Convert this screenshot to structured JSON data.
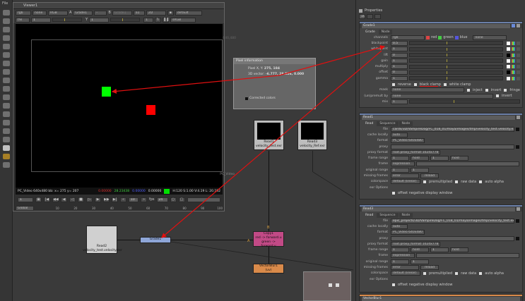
{
  "menu": {
    "file": "File"
  },
  "toolbar_icons": [
    "viewer-icon",
    "paint-icon",
    "time-icon",
    "channel-icon",
    "color-icon",
    "filter-icon",
    "keyer-icon",
    "merge-icon",
    "transform-icon",
    "3d-icon",
    "particles-icon",
    "deep-icon",
    "views-icon",
    "metadata-icon",
    "toolsets-icon",
    "other-icon",
    "gizmo-g-icon",
    "furnace-icon",
    "ocula-icon"
  ],
  "viewer": {
    "title": "Viewer1",
    "row1": [
      "rgb",
      "none",
      "RGB",
      "A",
      "Grade1",
      "-",
      "B",
      "Grade1",
      "a1",
      "2D",
      "default"
    ],
    "row2": {
      "fstop": "f/8",
      "one": "1",
      "gain": "1",
      "y_label": "Y",
      "gamma": "1",
      "proxy": "1",
      "lut": "sRGB"
    },
    "format_label": "PC_Video",
    "format_size": "640,480",
    "status": {
      "info": "PC_Video 640x480 bb: x= 275 y= 207",
      "r": "0.00000",
      "g": "28.23438",
      "b": "0.00000",
      "a": "0.00000",
      "hsvl": "H:120 S:1.00 V:4.19  L: 20.192",
      "swatch": "#00e000"
    },
    "frame": "1",
    "increment": "10",
    "fps_label": "fps",
    "fps": "24",
    "range": "Global",
    "timeline_ticks": [
      "10",
      "20",
      "30",
      "40",
      "50",
      "60",
      "70",
      "80",
      "90",
      "100"
    ]
  },
  "pixel_info": {
    "title": "Pixel information",
    "pixel_label": "Pixel X, Y:",
    "pixel_value": "275, 184",
    "vector_label": "3D vector:",
    "vector_value": "-6.777, 28.526, 0.000",
    "corrected_label": "Corrected colors"
  },
  "properties": {
    "title": "Properties",
    "count": "10",
    "grade": {
      "name": "Grade1",
      "tabs": [
        "Grade",
        "Node"
      ],
      "channels": {
        "label": "channels",
        "value": "rgb",
        "red": "red",
        "green": "green",
        "blue": "blue",
        "none": "none"
      },
      "knobs": [
        {
          "label": "blackpoint",
          "value": "0.5"
        },
        {
          "label": "whitepoint",
          "value": "1"
        },
        {
          "label": "lift",
          "value": "0"
        },
        {
          "label": "gain",
          "value": "1"
        },
        {
          "label": "multiply",
          "value": "1"
        },
        {
          "label": "offset",
          "value": "0"
        },
        {
          "label": "gamma",
          "value": "1"
        }
      ],
      "reverse": "reverse",
      "black_clamp": "black clamp",
      "white_clamp": "white clamp",
      "mask": {
        "label": "mask",
        "value": "none",
        "inject": "inject",
        "invert": "invert",
        "fringe": "fringe"
      },
      "unpremult": {
        "label": "(un)premult by",
        "value": "none",
        "invert": "invert"
      },
      "mix": {
        "label": "mix",
        "value": "1"
      }
    },
    "reads": [
      {
        "name": "Read1",
        "tabs": [
          "Read",
          "Sequence",
          "Node"
        ],
        "file": "cards/3D/VampireDog/FC_018_01/maya/images/tmp/velocity_test.velocity.exr",
        "cache": "auto",
        "format": "PC_Video 640x480",
        "proxy": "",
        "proxy_format": "root.proxy_format 1024x778",
        "frame_range": [
          "1",
          "hold",
          "1",
          "hold"
        ],
        "frame": "expression",
        "original_range": [
          "1",
          "1"
        ],
        "missing_frames": "error",
        "reload": "reload",
        "colorspace": "default (linear)",
        "premultiplied": "premultiplied",
        "raw_data": "raw data",
        "auto_alpha": "auto alpha",
        "exr_options": "exr Options",
        "offset_negative": "offset negative display window"
      },
      {
        "name": "Read3",
        "tabs": [
          "Read",
          "Sequence",
          "Node"
        ],
        "file": "epic_projects/3D/VampireDog/FC_018_01/maya/images/tmp/velocity_test.exr",
        "cache": "auto",
        "format": "PC_Video 640x480",
        "proxy": "",
        "proxy_format": "root.proxy_format 1024x778",
        "frame_range": [
          "1",
          "hold",
          "1",
          "hold"
        ],
        "frame": "expression",
        "original_range": [
          "1",
          "1"
        ],
        "missing_frames": "error",
        "reload": "reload",
        "colorspace": "default (linear)",
        "premultiplied": "premultiplied",
        "raw_data": "raw data",
        "auto_alpha": "auto alpha",
        "exr_options": "exr Options",
        "offset_negative": "offset negative display window"
      }
    ],
    "last_panel": "VectorBlur1"
  },
  "labels": {
    "proxy": "proxy",
    "format": "format",
    "file": "file",
    "cache": "cache locally",
    "proxy_format": "proxy format",
    "frame_range": "frame range",
    "frame": "frame",
    "original_range": "original range",
    "missing_frames": "missing frames",
    "colorspace": "colorspace"
  },
  "nodes": {
    "read1": {
      "name": "Read1",
      "file": "velocity_test.exr"
    },
    "read3": {
      "name": "Read3",
      "file": "velocity_Ref.exr"
    },
    "read2": {
      "name": "Read2",
      "file": "velocity_test.velocity.exr"
    },
    "grade1": {
      "name": "Grade1"
    },
    "copy1": {
      "name": "Copy1",
      "line1": "red -> forward.u",
      "line2": "green -> forward.v",
      "input_a": "A",
      "input_b": "B"
    },
    "vectorblur1": {
      "name": "VectorBlur1",
      "sub": "(uv)"
    }
  },
  "colors": {
    "grade_node": "#8ea6d8",
    "copy_node": "#c24a86",
    "vectorblur_node": "#d98a4a",
    "annotation": "#e01010",
    "green_patch": "#00ff00",
    "red_patch": "#ff0000"
  }
}
